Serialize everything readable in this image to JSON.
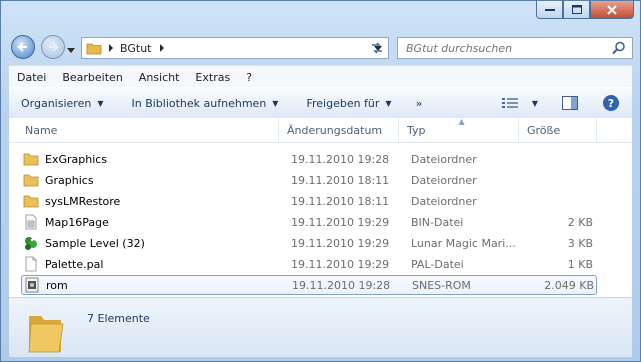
{
  "address": {
    "path": [
      "BGtut"
    ]
  },
  "search": {
    "placeholder": "BGtut durchsuchen"
  },
  "menu": {
    "items": [
      "Datei",
      "Bearbeiten",
      "Ansicht",
      "Extras",
      "?"
    ]
  },
  "toolbar": {
    "organize": "Organisieren",
    "library": "In Bibliothek aufnehmen",
    "share": "Freigeben für",
    "more": "»"
  },
  "columns": {
    "name": "Name",
    "date": "Änderungsdatum",
    "type": "Typ",
    "size": "Größe"
  },
  "files": [
    {
      "name": "ExGraphics",
      "date": "19.11.2010 19:28",
      "type": "Dateiordner",
      "size": "",
      "icon": "folder-icon"
    },
    {
      "name": "Graphics",
      "date": "19.11.2010 18:11",
      "type": "Dateiordner",
      "size": "",
      "icon": "folder-icon"
    },
    {
      "name": "sysLMRestore",
      "date": "19.11.2010 18:11",
      "type": "Dateiordner",
      "size": "",
      "icon": "folder-icon"
    },
    {
      "name": "Map16Page",
      "date": "19.11.2010 19:29",
      "type": "BIN-Datei",
      "size": "2 KB",
      "icon": "bin-file-icon"
    },
    {
      "name": "Sample Level (32)",
      "date": "19.11.2010 19:29",
      "type": "Lunar Magic Mari...",
      "size": "3 KB",
      "icon": "lunar-magic-icon"
    },
    {
      "name": "Palette.pal",
      "date": "19.11.2010 19:29",
      "type": "PAL-Datei",
      "size": "1 KB",
      "icon": "document-icon"
    },
    {
      "name": "rom",
      "date": "19.11.2010 19:28",
      "type": "SNES-ROM",
      "size": "2.049 KB",
      "icon": "rom-file-icon"
    }
  ],
  "status": {
    "count": "7 Elemente"
  }
}
